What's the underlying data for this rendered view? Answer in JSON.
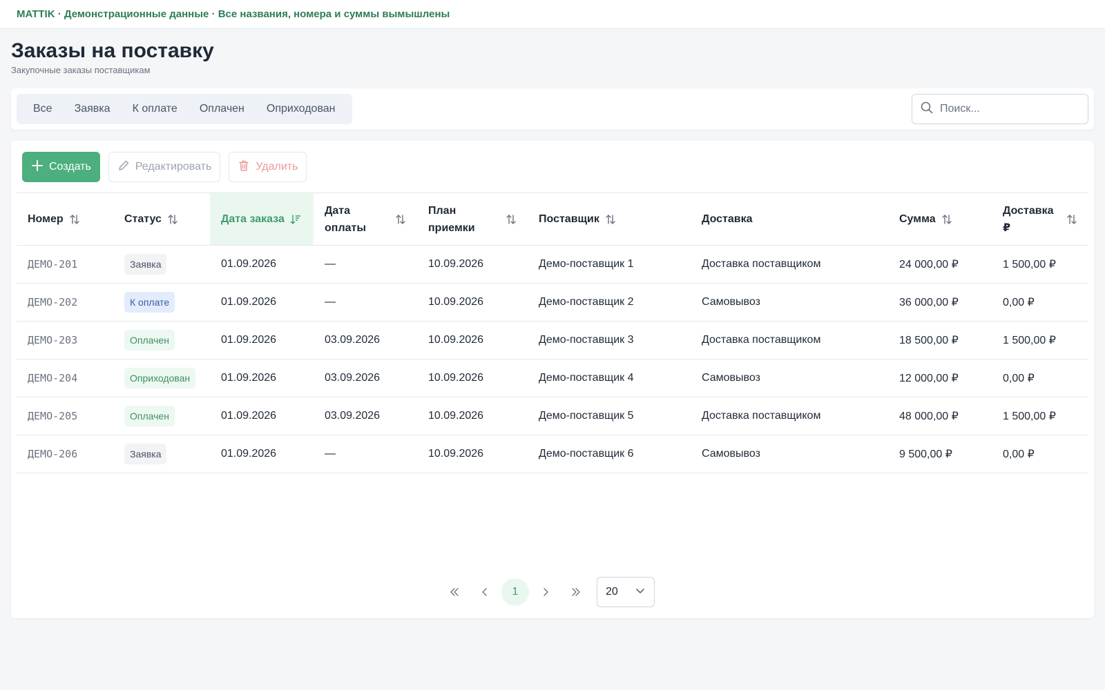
{
  "banner": "MATTIK · Демонстрационные данные · Все названия, номера и суммы вымышлены",
  "page": {
    "title": "Заказы на поставку",
    "subtitle": "Закупочные заказы поставщикам"
  },
  "filters": {
    "tabs": [
      "Все",
      "Заявка",
      "К оплате",
      "Оплачен",
      "Оприходован"
    ],
    "search_placeholder": "Поиск..."
  },
  "toolbar": {
    "create_label": "Создать",
    "edit_label": "Редактировать",
    "delete_label": "Удалить"
  },
  "table": {
    "columns": [
      "Номер",
      "Статус",
      "Дата заказа",
      "Дата оплаты",
      "План приемки",
      "Поставщик",
      "Доставка",
      "Сумма",
      "Доставка ₽"
    ],
    "sorted_column": "Дата заказа",
    "rows": [
      {
        "number": "ДЕМО-201",
        "status": "Заявка",
        "order_date": "01.09.2026",
        "pay_date": "—",
        "plan_date": "10.09.2026",
        "supplier": "Демо-поставщик 1",
        "delivery": "Доставка поставщиком",
        "sum": "24 000,00 ₽",
        "delivery_sum": "1 500,00 ₽"
      },
      {
        "number": "ДЕМО-202",
        "status": "К оплате",
        "order_date": "01.09.2026",
        "pay_date": "—",
        "plan_date": "10.09.2026",
        "supplier": "Демо-поставщик 2",
        "delivery": "Самовывоз",
        "sum": "36 000,00 ₽",
        "delivery_sum": "0,00 ₽"
      },
      {
        "number": "ДЕМО-203",
        "status": "Оплачен",
        "order_date": "01.09.2026",
        "pay_date": "03.09.2026",
        "plan_date": "10.09.2026",
        "supplier": "Демо-поставщик 3",
        "delivery": "Доставка поставщиком",
        "sum": "18 500,00 ₽",
        "delivery_sum": "1 500,00 ₽"
      },
      {
        "number": "ДЕМО-204",
        "status": "Оприходован",
        "order_date": "01.09.2026",
        "pay_date": "03.09.2026",
        "plan_date": "10.09.2026",
        "supplier": "Демо-поставщик 4",
        "delivery": "Самовывоз",
        "sum": "12 000,00 ₽",
        "delivery_sum": "0,00 ₽"
      },
      {
        "number": "ДЕМО-205",
        "status": "Оплачен",
        "order_date": "01.09.2026",
        "pay_date": "03.09.2026",
        "plan_date": "10.09.2026",
        "supplier": "Демо-поставщик 5",
        "delivery": "Доставка поставщиком",
        "sum": "48 000,00 ₽",
        "delivery_sum": "1 500,00 ₽"
      },
      {
        "number": "ДЕМО-206",
        "status": "Заявка",
        "order_date": "01.09.2026",
        "pay_date": "—",
        "plan_date": "10.09.2026",
        "supplier": "Демо-поставщик 6",
        "delivery": "Самовывоз",
        "sum": "9 500,00 ₽",
        "delivery_sum": "0,00 ₽"
      }
    ]
  },
  "status_colors": {
    "Заявка": {
      "bg": "#f1f3f5",
      "fg": "#4b5563"
    },
    "К оплате": {
      "bg": "#e3ecfb",
      "fg": "#3b5ba9"
    },
    "Оплачен": {
      "bg": "#ecf8f1",
      "fg": "#3f8f62"
    },
    "Оприходован": {
      "bg": "#ecf8f1",
      "fg": "#3f8f62"
    }
  },
  "pagination": {
    "current_page": "1",
    "rows_per_page": "20"
  },
  "colors": {
    "accent": "#4caf7d",
    "banner_text": "#2e7d57"
  }
}
